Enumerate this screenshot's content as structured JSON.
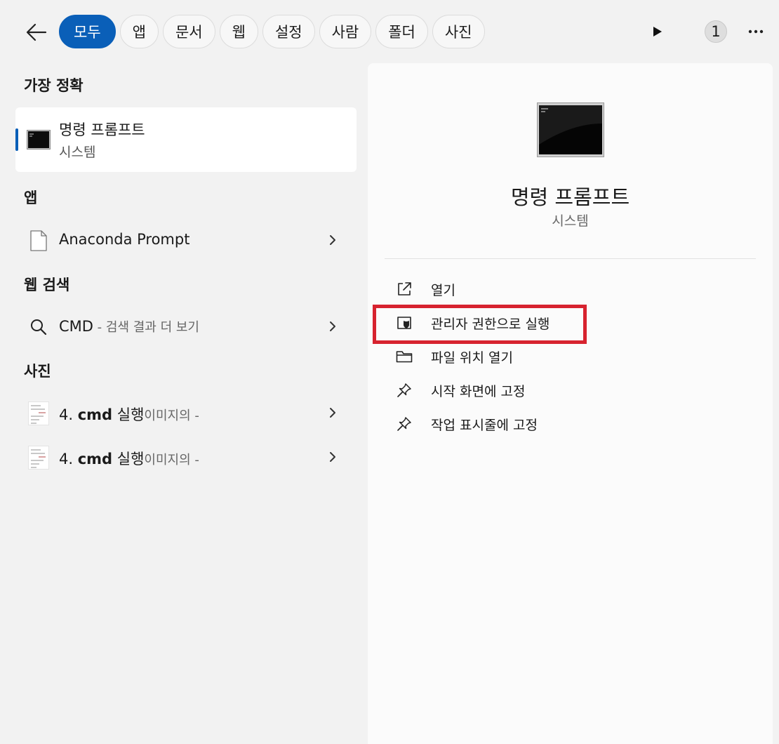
{
  "header": {
    "tabs": [
      "모두",
      "앱",
      "문서",
      "웹",
      "설정",
      "사람",
      "폴더",
      "사진"
    ],
    "active_tab": "모두",
    "badge_count": "1"
  },
  "left": {
    "best_match": {
      "heading": "가장 정확",
      "title": "명령 프롬프트",
      "subtitle": "시스템"
    },
    "apps": {
      "heading": "앱",
      "items": [
        {
          "label": "Anaconda Prompt"
        }
      ]
    },
    "web": {
      "heading": "웹 검색",
      "query": "CMD",
      "suffix": " - 검색 결과 더 보기"
    },
    "photos": {
      "heading": "사진",
      "items": [
        {
          "prefix": "4. ",
          "bold": "cmd",
          "middle": " 실행",
          "suffix": "이미지의 -"
        },
        {
          "prefix": "4. ",
          "bold": "cmd",
          "middle": " 실행",
          "suffix": "이미지의 -"
        }
      ]
    }
  },
  "detail": {
    "title": "명령 프롬프트",
    "subtitle": "시스템",
    "actions": [
      {
        "label": "열기",
        "icon": "open-external-icon"
      },
      {
        "label": "관리자 권한으로 실행",
        "icon": "shield-icon"
      },
      {
        "label": "파일 위치 열기",
        "icon": "folder-icon"
      },
      {
        "label": "시작 화면에 고정",
        "icon": "pin-icon"
      },
      {
        "label": "작업 표시줄에 고정",
        "icon": "pin-icon"
      }
    ]
  },
  "colors": {
    "accent": "#0a5fb8",
    "highlight": "#d7232f"
  }
}
